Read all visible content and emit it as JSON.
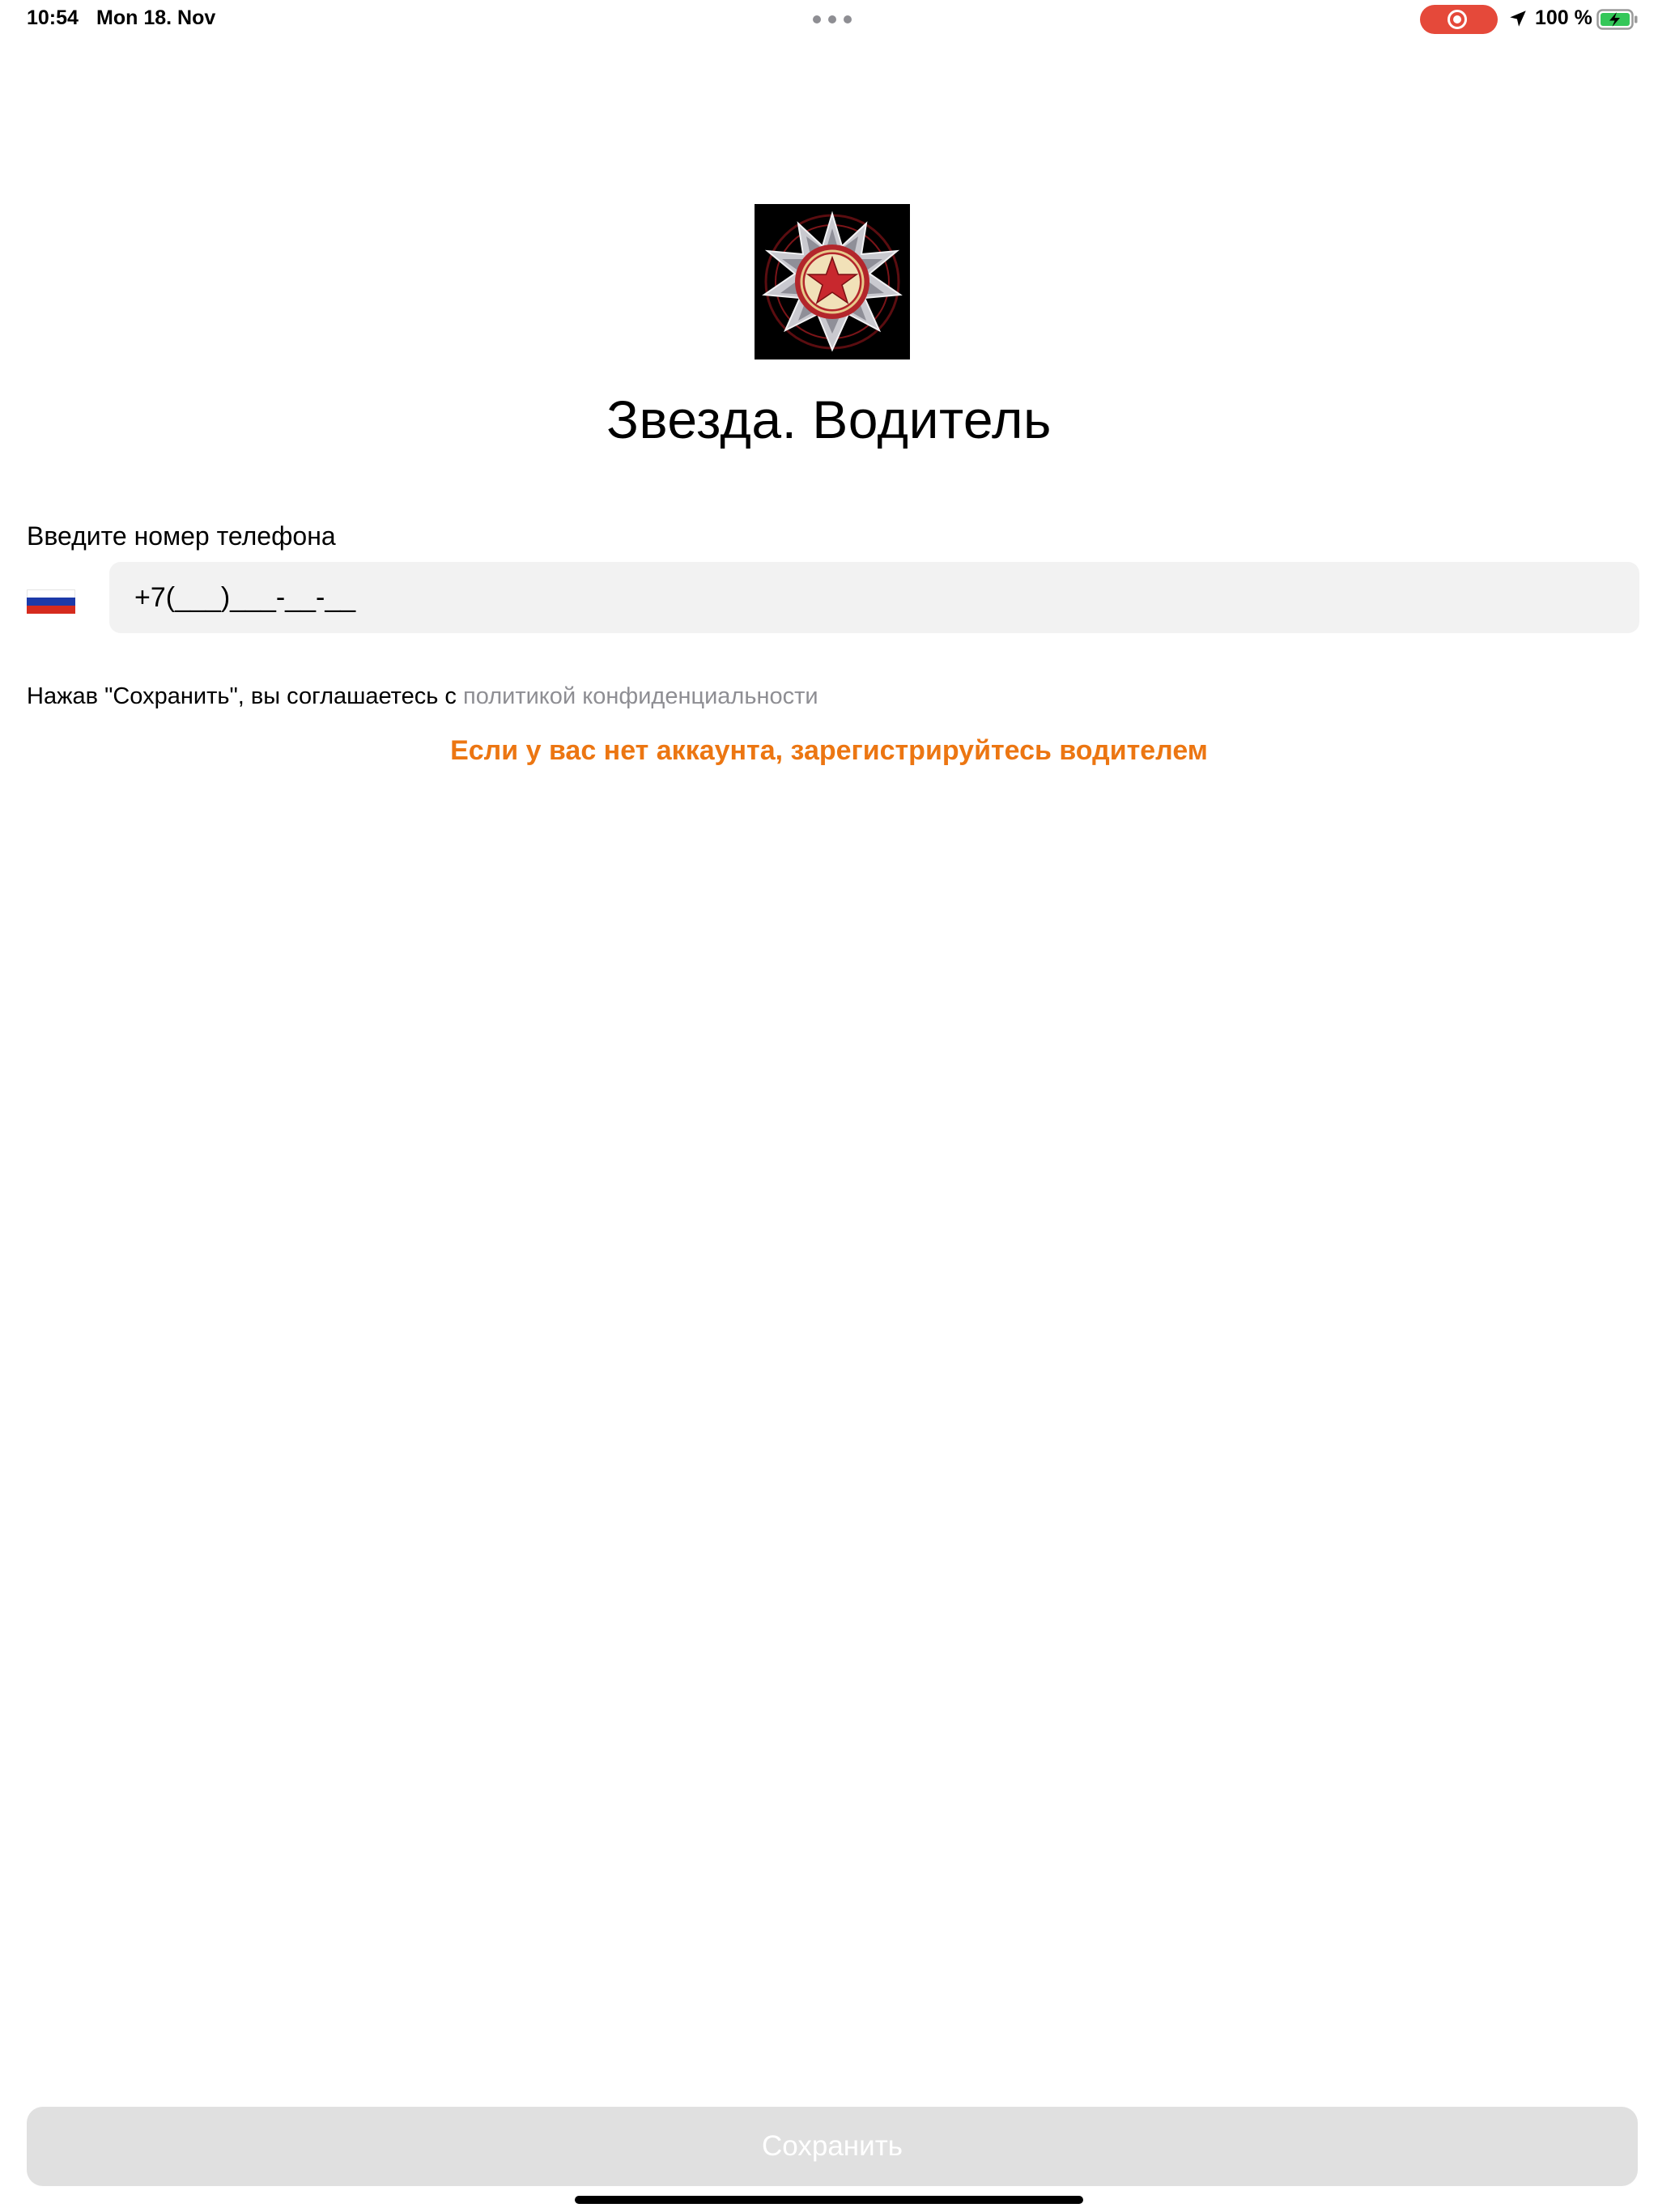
{
  "status_bar": {
    "time": "10:54",
    "date": "Mon 18. Nov",
    "battery_percent": "100 %",
    "recording_color": "#e5493a",
    "icons": [
      "multitask-dots",
      "screen-recording-icon",
      "location-arrow-icon",
      "battery-charging-icon"
    ]
  },
  "app": {
    "logo_icon": "red-star-badge-logo",
    "title": "Звезда. Водитель"
  },
  "phone": {
    "label": "Введите номер телефона",
    "country_flag": "russia-flag",
    "value": "+7(___)___-__-__"
  },
  "consent": {
    "prefix": "Нажав \"Сохранить\", вы соглашаетесь с ",
    "policy_link": "политикой конфиденциальности"
  },
  "register": {
    "text": "Если у вас нет аккаунта, зарегистрируйтесь водителем",
    "color": "#ec7612"
  },
  "save_button": {
    "label": "Сохранить",
    "state": "disabled"
  }
}
